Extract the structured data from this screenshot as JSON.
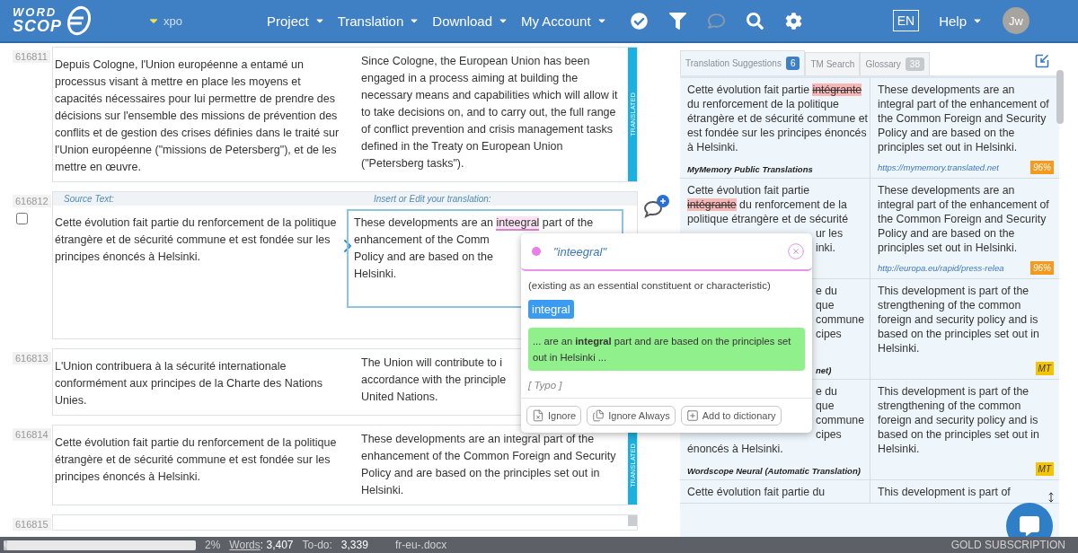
{
  "header": {
    "logo": {
      "top": "WORD",
      "bottom": "SCOP"
    },
    "project": "xpo",
    "menus": [
      {
        "label": "Project"
      },
      {
        "label": "Translation"
      },
      {
        "label": "Download"
      },
      {
        "label": "My Account"
      }
    ],
    "language": "EN",
    "help": "Help",
    "avatar": "Jw"
  },
  "segments": [
    {
      "id": "616811",
      "active": false,
      "translated": true,
      "status_label": "TRANSLATED",
      "source": "Depuis Cologne, l'Union européenne a entamé un processus visant à mettre en place les moyens et capacités nécessaires pour lui permettre de prendre des décisions sur l'ensemble des missions de prévention des conflits et de gestion des crises définies dans le traité sur l'Union européenne (\"missions de Petersberg\"), et de les mettre en œuvre.",
      "target": "Since Cologne, the European Union has been engaged in a process aiming at building the necessary means and capabilities which will allow it to take decisions on, and to carry out, the full range of conflict prevention and crisis management tasks defined in the Treaty on European Union (\"Petersberg tasks\")."
    },
    {
      "id": "616812",
      "active": true,
      "checked": false,
      "source_heading": "Source Text:",
      "target_heading": "Insert or Edit your translation:",
      "source": "Cette évolution fait partie du renforcement de la politique étrangère et de sécurité commune et est fondée sur les principes énoncés à Helsinki.",
      "target_lines": [
        [
          {
            "text": "These developments are an ",
            "kind": "plain"
          },
          {
            "text": "inteegral",
            "kind": "misspelled"
          },
          {
            "text": " part of the",
            "kind": "plain"
          }
        ],
        [
          {
            "text": "enhancement of the Comm",
            "kind": "plain"
          }
        ],
        [
          {
            "text": "Policy and are based on the",
            "kind": "plain"
          }
        ],
        [
          {
            "text": "Helsinki.",
            "kind": "plain"
          }
        ]
      ]
    },
    {
      "id": "616813",
      "active": false,
      "source": "L'Union contribuera à la sécurité internationale conformément aux principes de la Charte des Nations Unies.",
      "target_lines": [
        [
          {
            "text": "The Union will contribute to i",
            "kind": "plain"
          }
        ],
        [
          {
            "text": "accordance with the principle",
            "kind": "plain"
          }
        ],
        [
          {
            "text": "United Nations.",
            "kind": "plain"
          }
        ]
      ]
    },
    {
      "id": "616814",
      "active": false,
      "translated": true,
      "status_label": "TRANSLATED",
      "source": "Cette évolution fait partie du renforcement de la politique étrangère et de sécurité commune et est fondée sur les principes énoncés à Helsinki.",
      "target": "These developments are an integral part of the enhancement of the Common Foreign and Security Policy and are based on the principles set out in Helsinki."
    },
    {
      "id": "616815",
      "active": false,
      "translated": false
    }
  ],
  "panel": {
    "tabs": [
      {
        "label": "Translation Suggestions",
        "count": "6",
        "selected": true
      },
      {
        "label": "TM Search",
        "selected": false
      },
      {
        "label": "Glossary",
        "count": "38",
        "selected": false
      }
    ],
    "suggestions": [
      {
        "source_lines": [
          {
            "kind": "full",
            "parts": [
              {
                "text": "Cette évolution fait partie ",
                "kind": "plain"
              },
              {
                "text": "intégrante",
                "kind": "deleted"
              },
              {
                "text": " du renforcement de la politique étrangère et de sécurité commune et est fondée sur les principes énoncés à Helsinki.",
                "kind": "plain"
              }
            ]
          }
        ],
        "origin": {
          "text": "MyMemory Public Translations",
          "kind": "full"
        },
        "target": "These developments are an integral part of the enhancement of the Common Foreign and Security Policy and are based on the principles set out in Helsinki.",
        "link": "https://mymemory.translated.net",
        "score": {
          "text": "96%",
          "kind": "match"
        }
      },
      {
        "source_lines": [
          {
            "kind": "full",
            "parts": [
              {
                "text": "Cette évolution fait partie",
                "kind": "plain"
              }
            ]
          },
          {
            "kind": "full",
            "parts": [
              {
                "text": "intégrante",
                "kind": "deleted"
              },
              {
                "text": " du renforcement de la",
                "kind": "plain"
              }
            ]
          },
          {
            "kind": "full",
            "parts": [
              {
                "text": "politique étrangère et de sécurité",
                "kind": "plain"
              }
            ]
          },
          {
            "kind": "tail",
            "parts": [
              {
                "text": "ur les",
                "kind": "plain"
              }
            ]
          },
          {
            "kind": "tail",
            "parts": [
              {
                "text": "inki.",
                "kind": "plain"
              }
            ]
          }
        ],
        "target": "These developments are an integral part of the enhancement of the Common Foreign and Security Policy and are based on the principles set out in Helsinki.",
        "link": "http://europa.eu/rapid/press-relea",
        "score": {
          "text": "96%",
          "kind": "match"
        }
      },
      {
        "source_lines": [
          {
            "kind": "tail",
            "parts": [
              {
                "text": "e du",
                "kind": "plain"
              }
            ]
          },
          {
            "kind": "tail",
            "parts": [
              {
                "text": "que",
                "kind": "plain"
              }
            ]
          },
          {
            "kind": "tail",
            "parts": [
              {
                "text": "commune",
                "kind": "plain"
              }
            ]
          },
          {
            "kind": "tail",
            "parts": [
              {
                "text": "cipes",
                "kind": "plain"
              }
            ]
          }
        ],
        "origin": {
          "text": "net)",
          "kind": "tail"
        },
        "target": "This development is part of the strengthening of the common foreign and security policy and is based on the principles set out in Helsinki.",
        "score": {
          "text": "MT",
          "kind": "mt"
        }
      },
      {
        "source_lines": [
          {
            "kind": "tail",
            "parts": [
              {
                "text": "e du",
                "kind": "plain"
              }
            ]
          },
          {
            "kind": "tail",
            "parts": [
              {
                "text": "que",
                "kind": "plain"
              }
            ]
          },
          {
            "kind": "tail",
            "parts": [
              {
                "text": "commune",
                "kind": "plain"
              }
            ]
          },
          {
            "kind": "tail",
            "parts": [
              {
                "text": "cipes",
                "kind": "plain"
              }
            ]
          },
          {
            "kind": "full",
            "parts": [
              {
                "text": "énoncés à Helsinki.",
                "kind": "plain"
              }
            ]
          }
        ],
        "origin": {
          "text": "Wordscope Neural (Automatic Translation)",
          "kind": "full"
        },
        "target": "This development is part of the strengthening of the common foreign and security policy and is based on the principles set out in Helsinki.",
        "score": {
          "text": "MT",
          "kind": "mt"
        }
      },
      {
        "source_lines": [
          {
            "kind": "full",
            "parts": [
              {
                "text": "Cette évolution fait partie du",
                "kind": "plain"
              }
            ]
          }
        ],
        "target": "This development is part of"
      }
    ]
  },
  "spell_popup": {
    "word": "\"inteegral\"",
    "definition": "(existing as an essential constituent or characteristic)",
    "suggestions": [
      "integral"
    ],
    "example": "... are an **integral** part and are based on the principles set out in Helsinki ...",
    "category": "[ Typo ]",
    "actions": [
      {
        "label": "Ignore",
        "kind": "ignore"
      },
      {
        "label": "Ignore Always",
        "kind": "ignore_always"
      },
      {
        "label": "Add to dictionary",
        "kind": "add"
      }
    ]
  },
  "status_bar": {
    "progress": {
      "level": 0.02
    },
    "percent": "2%",
    "words_label": "Words",
    "words": ": 3,407",
    "todo_label": "To-do:",
    "todo": "3,339",
    "file": "fr-eu-.docx",
    "plan": "GOLD SUBSCRIPTION"
  }
}
